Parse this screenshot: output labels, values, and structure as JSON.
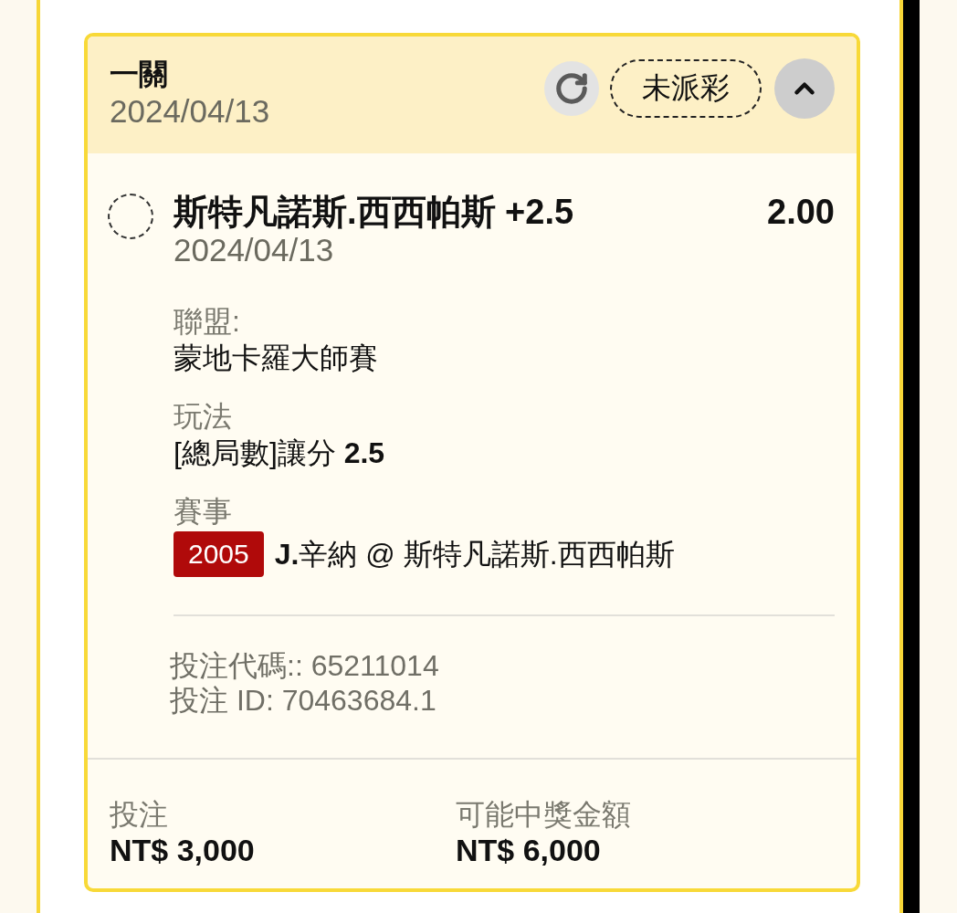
{
  "card": {
    "header": {
      "title": "一關",
      "date": "2024/04/13",
      "status": "未派彩",
      "expanded": true
    },
    "selection": {
      "checked": false,
      "name": "斯特凡諾斯.西西帕斯 +2.5",
      "odds": "2.00",
      "date": "2024/04/13"
    },
    "details": [
      {
        "label": "聯盟:",
        "value": "蒙地卡羅大師賽"
      },
      {
        "label": "玩法",
        "value": "[總局數]讓分 **2.5**"
      },
      {
        "label": "賽事",
        "badge": "2005",
        "value": "**J.**辛納 @ 斯特凡諾斯.西西帕斯"
      }
    ],
    "bet_code": "投注代碼:: 65211014",
    "bet_id": "投注 ID: 70463684.1",
    "footer": [
      {
        "label": "投注",
        "amount": "NT$ 3,000"
      },
      {
        "label": "可能中獎金額",
        "amount": "NT$ 6,000"
      }
    ]
  }
}
